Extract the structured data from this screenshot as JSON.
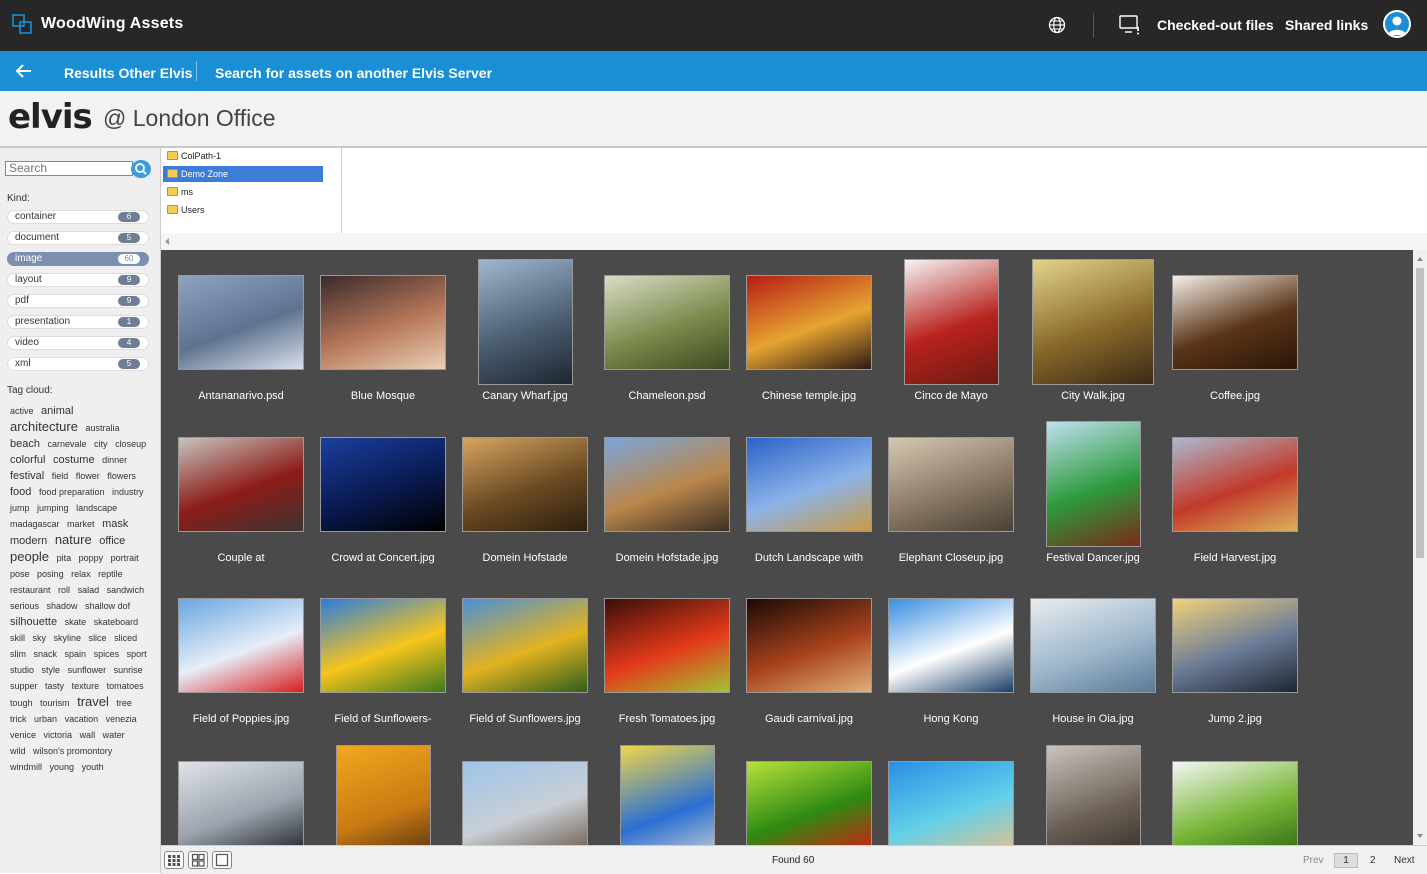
{
  "topbar": {
    "app_title": "WoodWing Assets",
    "checked_out_label": "Checked-out files",
    "shared_links_label": "Shared links"
  },
  "bluebar": {
    "results_label": "Results Other Elvis",
    "search_other_label": "Search for assets on another Elvis Server"
  },
  "header": {
    "logo_text": "elvis",
    "server_name": "@ London Office"
  },
  "sidebar": {
    "search_placeholder": "Search",
    "kind_label": "Kind:",
    "kinds": [
      {
        "label": "container",
        "count": "6"
      },
      {
        "label": "document",
        "count": "5"
      },
      {
        "label": "image",
        "count": "60"
      },
      {
        "label": "layout",
        "count": "9"
      },
      {
        "label": "pdf",
        "count": "9"
      },
      {
        "label": "presentation",
        "count": "1"
      },
      {
        "label": "video",
        "count": "4"
      },
      {
        "label": "xml",
        "count": "5"
      }
    ],
    "tag_cloud_label": "Tag cloud:",
    "tags": [
      [
        "active",
        1
      ],
      [
        "animal",
        2
      ],
      [
        "architecture",
        3
      ],
      [
        "australia",
        1
      ],
      [
        "beach",
        2
      ],
      [
        "carnevale",
        1
      ],
      [
        "city",
        1
      ],
      [
        "closeup",
        1
      ],
      [
        "colorful",
        2
      ],
      [
        "costume",
        2
      ],
      [
        "dinner",
        1
      ],
      [
        "festival",
        2
      ],
      [
        "field",
        1
      ],
      [
        "flower",
        1
      ],
      [
        "flowers",
        1
      ],
      [
        "food",
        2
      ],
      [
        "food preparation",
        1
      ],
      [
        "industry",
        1
      ],
      [
        "jump",
        1
      ],
      [
        "jumping",
        1
      ],
      [
        "landscape",
        1
      ],
      [
        "madagascar",
        1
      ],
      [
        "market",
        1
      ],
      [
        "mask",
        2
      ],
      [
        "modern",
        2
      ],
      [
        "nature",
        3
      ],
      [
        "office",
        2
      ],
      [
        "people",
        3
      ],
      [
        "pita",
        1
      ],
      [
        "poppy",
        1
      ],
      [
        "portrait",
        1
      ],
      [
        "pose",
        1
      ],
      [
        "posing",
        1
      ],
      [
        "relax",
        1
      ],
      [
        "reptile",
        1
      ],
      [
        "restaurant",
        1
      ],
      [
        "roll",
        1
      ],
      [
        "salad",
        1
      ],
      [
        "sandwich",
        1
      ],
      [
        "serious",
        1
      ],
      [
        "shadow",
        1
      ],
      [
        "shallow dof",
        1
      ],
      [
        "silhouette",
        2
      ],
      [
        "skate",
        1
      ],
      [
        "skateboard",
        1
      ],
      [
        "skill",
        1
      ],
      [
        "sky",
        1
      ],
      [
        "skyline",
        1
      ],
      [
        "slice",
        1
      ],
      [
        "sliced",
        1
      ],
      [
        "slim",
        1
      ],
      [
        "snack",
        1
      ],
      [
        "spain",
        1
      ],
      [
        "spices",
        1
      ],
      [
        "sport",
        1
      ],
      [
        "studio",
        1
      ],
      [
        "style",
        1
      ],
      [
        "sunflower",
        1
      ],
      [
        "sunrise",
        1
      ],
      [
        "supper",
        1
      ],
      [
        "tasty",
        1
      ],
      [
        "texture",
        1
      ],
      [
        "tomatoes",
        1
      ],
      [
        "tough",
        1
      ],
      [
        "tourism",
        1
      ],
      [
        "travel",
        3
      ],
      [
        "tree",
        1
      ],
      [
        "trick",
        1
      ],
      [
        "urban",
        1
      ],
      [
        "vacation",
        1
      ],
      [
        "venezia",
        1
      ],
      [
        "venice",
        1
      ],
      [
        "victoria",
        1
      ],
      [
        "wall",
        1
      ],
      [
        "water",
        1
      ],
      [
        "wild",
        1
      ],
      [
        "wilson's promontory",
        1
      ],
      [
        "windmill",
        1
      ],
      [
        "young",
        1
      ],
      [
        "youth",
        1
      ]
    ]
  },
  "folders": [
    {
      "label": "ColPath-1",
      "selected": false
    },
    {
      "label": "Demo Zone",
      "selected": true
    },
    {
      "label": "ms",
      "selected": false
    },
    {
      "label": "Users",
      "selected": false
    }
  ],
  "assets": [
    {
      "name": "Antananarivo.psd",
      "shape": "land",
      "colors": [
        "#8fa3c0",
        "#5f7390",
        "#d9e0ea"
      ]
    },
    {
      "name": "Blue Mosque",
      "shape": "land",
      "colors": [
        "#3a2a2a",
        "#b7785a",
        "#ead0b5"
      ]
    },
    {
      "name": "Canary Wharf.jpg",
      "shape": "port",
      "colors": [
        "#9fb7cf",
        "#4d5f73",
        "#1d2630"
      ]
    },
    {
      "name": "Chameleon.psd",
      "shape": "land",
      "colors": [
        "#d8ddc8",
        "#7c8a4c",
        "#3c4a22"
      ]
    },
    {
      "name": "Chinese temple.jpg",
      "shape": "land",
      "colors": [
        "#b51d16",
        "#e6a431",
        "#2d1a12"
      ]
    },
    {
      "name": "Cinco de Mayo",
      "shape": "port",
      "colors": [
        "#f5f5f5",
        "#b8221d",
        "#6b1b12"
      ]
    },
    {
      "name": "City Walk.jpg",
      "shape": "squareish",
      "colors": [
        "#e2d48a",
        "#8a6a2c",
        "#3a2a14"
      ]
    },
    {
      "name": "Coffee.jpg",
      "shape": "land",
      "colors": [
        "#f4efe8",
        "#5a3418",
        "#2a1608"
      ]
    },
    {
      "name": "Couple at",
      "shape": "land",
      "colors": [
        "#c7c4bf",
        "#8d1c18",
        "#3c3431"
      ]
    },
    {
      "name": "Crowd at Concert.jpg",
      "shape": "land",
      "colors": [
        "#1a3f9e",
        "#0a1a50",
        "#000000"
      ]
    },
    {
      "name": "Domein Hofstade",
      "shape": "land",
      "colors": [
        "#d6a560",
        "#6b4a23",
        "#2c1f10"
      ]
    },
    {
      "name": "Domein Hofstade.jpg",
      "shape": "land",
      "colors": [
        "#7aa6d9",
        "#b9864c",
        "#3c2e22"
      ]
    },
    {
      "name": "Dutch Landscape with",
      "shape": "land",
      "colors": [
        "#2a62c8",
        "#8cb3e8",
        "#c89a44"
      ]
    },
    {
      "name": "Elephant Closeup.jpg",
      "shape": "land",
      "colors": [
        "#d6c9b2",
        "#8a7a66",
        "#4a3f33"
      ]
    },
    {
      "name": "Festival Dancer.jpg",
      "shape": "port",
      "colors": [
        "#bfe0f0",
        "#2c9a3c",
        "#7a2a1a"
      ]
    },
    {
      "name": "Field Harvest.jpg",
      "shape": "land",
      "colors": [
        "#aabad0",
        "#c23a2a",
        "#d9b25c"
      ]
    },
    {
      "name": "Field of Poppies.jpg",
      "shape": "land",
      "colors": [
        "#6aa6e2",
        "#e6eef8",
        "#d81f1f"
      ]
    },
    {
      "name": "Field of Sunflowers-",
      "shape": "land",
      "colors": [
        "#2a7ce0",
        "#f7c51d",
        "#3d7a1c"
      ]
    },
    {
      "name": "Field of Sunflowers.jpg",
      "shape": "land",
      "colors": [
        "#4a8fd9",
        "#e3b320",
        "#2f5f1a"
      ]
    },
    {
      "name": "Fresh Tomatoes.jpg",
      "shape": "land",
      "colors": [
        "#3a0e08",
        "#e33a1a",
        "#a4c232"
      ]
    },
    {
      "name": "Gaudi carnival.jpg",
      "shape": "land",
      "colors": [
        "#1a0a06",
        "#a8421c",
        "#e0b07a"
      ]
    },
    {
      "name": "Hong Kong",
      "shape": "land",
      "colors": [
        "#3a8ee0",
        "#ffffff",
        "#1c3f6a"
      ]
    },
    {
      "name": "House in Oia.jpg",
      "shape": "land",
      "colors": [
        "#e8ecef",
        "#9fb8cc",
        "#5a7a96"
      ]
    },
    {
      "name": "Jump 2.jpg",
      "shape": "land",
      "colors": [
        "#f2d27a",
        "#6a7a96",
        "#1d2530"
      ]
    },
    {
      "name": "",
      "shape": "land",
      "colors": [
        "#dfe3e8",
        "#9ba3ad",
        "#1d2127"
      ]
    },
    {
      "name": "",
      "shape": "port",
      "colors": [
        "#f2a81e",
        "#c97a12",
        "#3a2410"
      ]
    },
    {
      "name": "",
      "shape": "land",
      "colors": [
        "#9ec4e8",
        "#c9cfd6",
        "#6a5a4a"
      ]
    },
    {
      "name": "",
      "shape": "port",
      "colors": [
        "#f0d64a",
        "#2a6fd2",
        "#e8e0d0"
      ]
    },
    {
      "name": "",
      "shape": "land",
      "colors": [
        "#b6e23a",
        "#2f8a12",
        "#d81a12"
      ]
    },
    {
      "name": "",
      "shape": "land",
      "colors": [
        "#2a8ee6",
        "#63d0e8",
        "#e8c08a"
      ]
    },
    {
      "name": "",
      "shape": "port",
      "colors": [
        "#c9c4bd",
        "#6a5f54",
        "#2a2420"
      ]
    },
    {
      "name": "",
      "shape": "land",
      "colors": [
        "#f4f6f4",
        "#7ab83a",
        "#2f6a12"
      ]
    }
  ],
  "bottombar": {
    "found_label": "Found 60",
    "prev_label": "Prev",
    "current_page": "1",
    "next_page": "2",
    "next_label": "Next"
  }
}
